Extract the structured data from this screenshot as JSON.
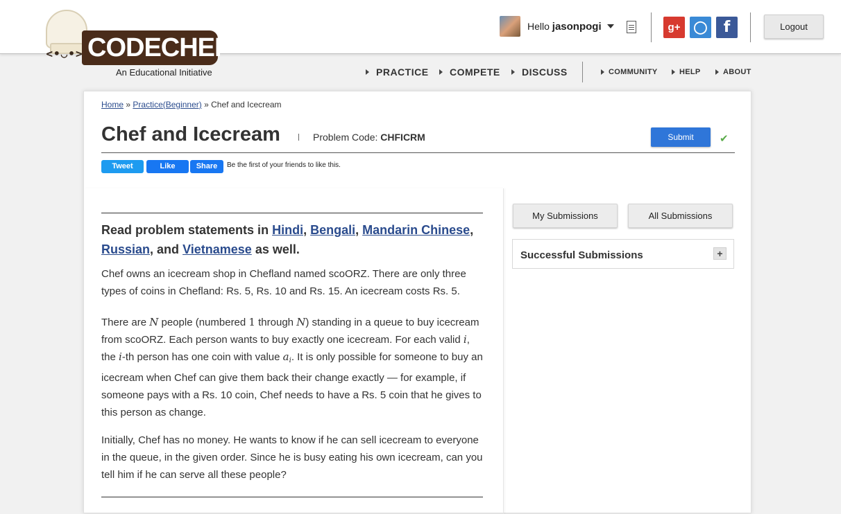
{
  "header": {
    "logo_text": "CODECHEF",
    "logo_face": "<•◡•>",
    "logo_subtitle": "An Educational Initiative",
    "greeting": "Hello",
    "username": "jasonpogi",
    "social": {
      "gplus": "g+",
      "github": "◯",
      "facebook": "f"
    },
    "logout_label": "Logout"
  },
  "nav": {
    "main": [
      "PRACTICE",
      "COMPETE",
      "DISCUSS"
    ],
    "secondary": [
      "COMMUNITY",
      "HELP",
      "ABOUT"
    ]
  },
  "breadcrumb": {
    "home": "Home",
    "sep1": "»",
    "practice": "Practice(Beginner)",
    "sep2": "»",
    "current": "Chef and Icecream"
  },
  "problem": {
    "title": "Chef and Icecream",
    "code_label": "Problem Code:",
    "code": "CHFICRM",
    "submit_label": "Submit",
    "check_glyph": "✔"
  },
  "share": {
    "tweet": "Tweet",
    "like": "Like",
    "share": "Share",
    "friends_text": "Be the first of your friends to like this."
  },
  "statement": {
    "langs_prefix": "Read problem statements in",
    "langs": [
      "Hindi",
      "Bengali",
      "Mandarin Chinese",
      "Russian",
      "Vietnamese"
    ],
    "langs_sep1": ",",
    "langs_sep2": ",",
    "langs_sep3": ",",
    "langs_and": ", and",
    "langs_suffix": "as well.",
    "para1": "Chef owns an icecream shop in Chefland named scoORZ. There are only three types of coins in Chefland: Rs. 5, Rs. 10 and Rs. 15. An icecream costs Rs. 5.",
    "para2": {
      "t1": "There are ",
      "n1": "N",
      "t2": " people (numbered ",
      "one": "1",
      "t3": " through ",
      "n2": "N",
      "t4": ") standing in a queue to buy icecream from scoORZ. Each person wants to buy exactly one icecream. For each valid ",
      "i1": "i",
      "t5": ", the ",
      "i2": "i",
      "t6": "-th person has one coin with value ",
      "a": "a",
      "ai": "i",
      "t7": ". It is only possible for someone to buy an icecream when Chef can give them back their change exactly — for example, if someone pays with a Rs. 10 coin, Chef needs to have a Rs. 5 coin that he gives to this person as change."
    },
    "para3": "Initially, Chef has no money. He wants to know if he can sell icecream to everyone in the queue, in the given order. Since he is busy eating his own icecream, can you tell him if he can serve all these people?"
  },
  "sidebar": {
    "my_submissions": "My Submissions",
    "all_submissions": "All Submissions",
    "successful_title": "Successful Submissions",
    "expand_glyph": "+"
  }
}
